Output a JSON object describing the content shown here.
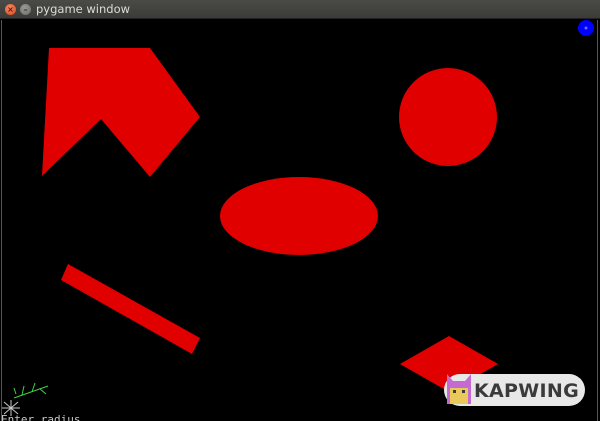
{
  "window": {
    "title": "pygame window",
    "close_glyph": "×",
    "minimize_glyph": "–"
  },
  "canvas": {
    "background": "#000000",
    "shape_color": "#e00000",
    "indicator_color": "#0000ff",
    "shapes": [
      {
        "kind": "polygon",
        "name": "red-polygon"
      },
      {
        "kind": "circle",
        "name": "red-circle"
      },
      {
        "kind": "ellipse",
        "name": "red-ellipse"
      },
      {
        "kind": "line",
        "name": "red-thick-line"
      },
      {
        "kind": "diamond",
        "name": "red-diamond"
      },
      {
        "kind": "circle",
        "name": "blue-indicator-dot"
      }
    ]
  },
  "prompt": {
    "text": "Enter radius"
  },
  "watermark": {
    "text": "KAPWING",
    "logo_icon": "kapwing-cat-icon"
  }
}
